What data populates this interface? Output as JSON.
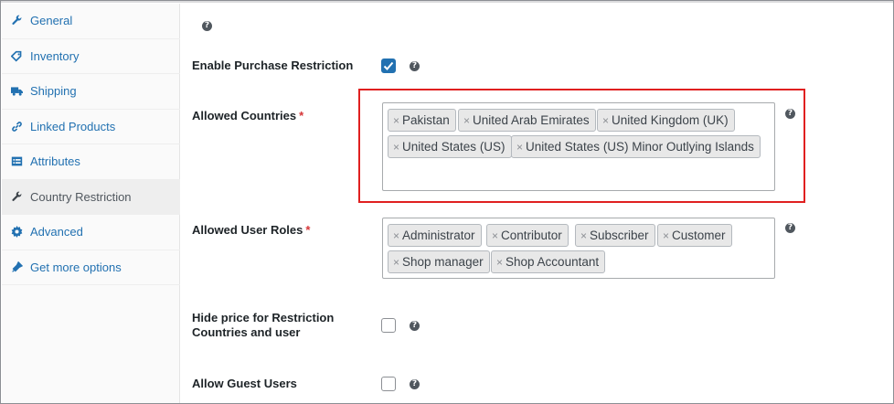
{
  "sidebar": {
    "items": [
      {
        "label": "General",
        "icon": "wrench-icon",
        "active": false
      },
      {
        "label": "Inventory",
        "icon": "tag-icon",
        "active": false
      },
      {
        "label": "Shipping",
        "icon": "truck-icon",
        "active": false
      },
      {
        "label": "Linked Products",
        "icon": "link-icon",
        "active": false
      },
      {
        "label": "Attributes",
        "icon": "list-icon",
        "active": false
      },
      {
        "label": "Country Restriction",
        "icon": "wrench-icon",
        "active": true
      },
      {
        "label": "Advanced",
        "icon": "gear-icon",
        "active": false
      },
      {
        "label": "Get more options",
        "icon": "plugin-icon",
        "active": false
      }
    ]
  },
  "form": {
    "help_glyph": "?",
    "required_mark": "*",
    "remove_glyph": "×",
    "enable_purchase": {
      "label": "Enable Purchase Restriction",
      "checked": true
    },
    "allowed_countries": {
      "label": "Allowed Countries",
      "tags": [
        "Pakistan",
        "United Arab Emirates",
        "United Kingdom (UK)",
        "United States (US)",
        "United States (US) Minor Outlying Islands"
      ]
    },
    "allowed_roles": {
      "label": "Allowed User Roles",
      "tags": [
        "Administrator",
        "Contributor",
        "Subscriber",
        "Customer",
        "Shop manager",
        "Shop Accountant"
      ]
    },
    "hide_price": {
      "label_line1": "Hide price for Restriction",
      "label_line2": "Countries and user",
      "checked": false
    },
    "guest_users": {
      "label": "Allow Guest Users",
      "checked": false
    }
  },
  "colors": {
    "link": "#2271b1",
    "highlight": "#e02020",
    "required": "#d63638"
  }
}
